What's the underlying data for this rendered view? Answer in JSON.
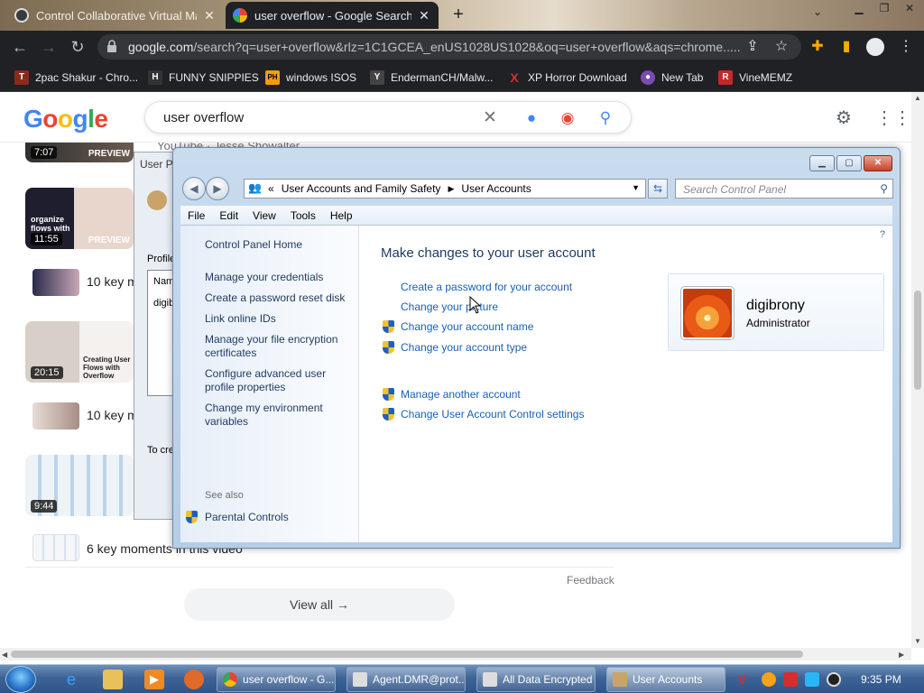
{
  "chrome": {
    "tabs": [
      {
        "title": "Control Collaborative Virtual Ma",
        "active": false
      },
      {
        "title": "user overflow - Google Search",
        "active": true
      }
    ],
    "new_tab_symbol": "+",
    "url_host": "google.com",
    "url_path": "/search?q=user+overflow&rlz=1C1GCEA_enUS1028US1028&oq=user+overflow&aqs=chrome.....",
    "bookmarks": [
      {
        "label": "2pac Shakur - Chro...",
        "icon": "T",
        "color": "#8a2b1a"
      },
      {
        "label": "FUNNY SNIPPIES",
        "icon": "H",
        "color": "#333333"
      },
      {
        "label": "windows ISOS",
        "icon": "PH",
        "color": "#f29c0d"
      },
      {
        "label": "EndermanCH/Malw...",
        "icon": "Y",
        "color": "#444444"
      },
      {
        "label": "XP Horror Download",
        "icon": "X",
        "color": "#d32f2f"
      },
      {
        "label": "New Tab",
        "icon": "●",
        "color": "#7a4bb5"
      },
      {
        "label": "VineMEMZ",
        "icon": "R",
        "color": "#c62828"
      }
    ]
  },
  "google": {
    "logo": "Google",
    "query": "user overflow",
    "youtube_line": "YouTube · Jesse Showalter",
    "videos": [
      {
        "duration": "7:07",
        "preview": "PREVIEW",
        "caption": ""
      },
      {
        "duration": "11:55",
        "preview": "PREVIEW",
        "caption": "organize flows with"
      },
      {
        "duration": "20:15",
        "preview": "",
        "caption": "Creating User Flows with Overflow"
      },
      {
        "duration": "9:44",
        "preview": "",
        "caption": ""
      }
    ],
    "key_moments": [
      "10 key m",
      "10 key m",
      "6 key moments in this video"
    ],
    "feedback": "Feedback",
    "view_all": "View all"
  },
  "bg_dialog": {
    "title": "User Pr",
    "profile_label": "Profile",
    "col_name": "Nam",
    "row_user": "digib",
    "bottom_text": "To cre"
  },
  "control_panel": {
    "breadcrumb_prefix": "«",
    "breadcrumb": [
      "User Accounts and Family Safety",
      "User Accounts"
    ],
    "search_placeholder": "Search Control Panel",
    "menu": [
      "File",
      "Edit",
      "View",
      "Tools",
      "Help"
    ],
    "left_links": [
      "Control Panel Home",
      "Manage your credentials",
      "Create a password reset disk",
      "Link online IDs",
      "Manage your file encryption certificates",
      "Configure advanced user profile properties",
      "Change my environment variables"
    ],
    "see_also": "See also",
    "parental_controls": "Parental Controls",
    "heading": "Make changes to your user account",
    "actions": [
      "Create a password for your account",
      "Change your picture",
      "Change your account name",
      "Change your account type"
    ],
    "other_actions": [
      "Manage another account",
      "Change User Account Control settings"
    ],
    "user_name": "digibrony",
    "user_role": "Administrator"
  },
  "taskbar": {
    "buttons": [
      {
        "label": "user overflow - G...",
        "active": false
      },
      {
        "label": "Agent.DMR@prot...",
        "active": false
      },
      {
        "label": "All Data Encrypted",
        "active": false
      },
      {
        "label": "User Accounts",
        "active": true
      }
    ],
    "time": "9:35 PM"
  }
}
